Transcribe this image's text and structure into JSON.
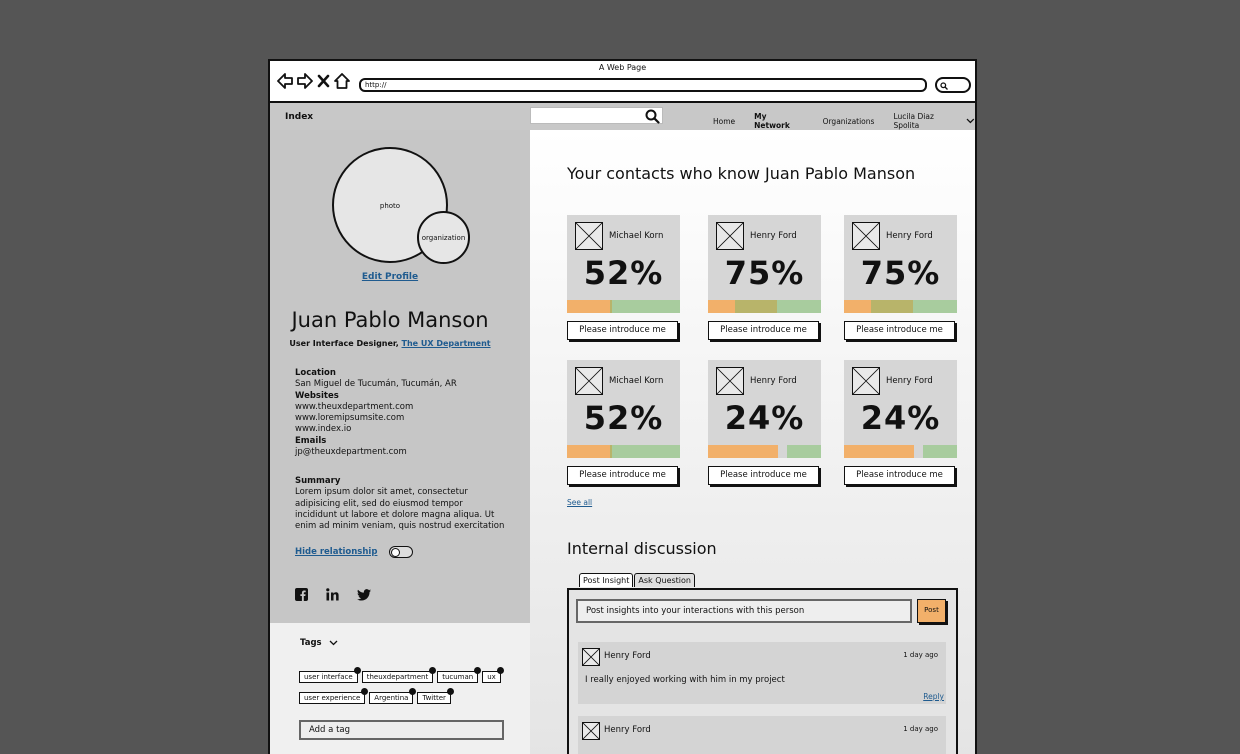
{
  "window": {
    "title": "A Web Page",
    "url": "http://"
  },
  "colors": {
    "orange": "#f2b06a",
    "olive": "#b8b46a",
    "green": "#a8cc9e",
    "link": "#1f5b8f"
  },
  "header": {
    "brand": "Index",
    "search_placeholder": "",
    "nav": [
      {
        "label": "Home",
        "active": false
      },
      {
        "label": "My Network",
        "active": true
      },
      {
        "label": "Organizations",
        "active": false
      }
    ],
    "user": "Lucila Diaz Spolita"
  },
  "profile": {
    "photo_label": "photo",
    "org_label": "organization",
    "edit_link": "Edit Profile",
    "name": "Juan Pablo Manson",
    "role": "User Interface Designer,",
    "department": "The UX Department",
    "location_label": "Location",
    "location": "San Miguel de Tucumán, Tucumán, AR",
    "websites_label": "Websites",
    "websites": [
      "www.theuxdepartment.com",
      "www.loremipsumsite.com",
      "www.index.io"
    ],
    "emails_label": "Emails",
    "email": "jp@theuxdepartment.com",
    "summary_label": "Summary",
    "summary_lines": [
      "Lorem ipsum dolor sit amet, consectetur",
      "adipisicing elit, sed do eiusmod tempor",
      "incididunt ut labore et dolore magna aliqua. Ut",
      "enim ad minim veniam, quis nostrud exercitation"
    ],
    "hide_relationship": "Hide relationship",
    "socials": [
      "facebook-icon",
      "linkedin-icon",
      "twitter-icon"
    ]
  },
  "tags": {
    "title": "Tags",
    "items": [
      "user interface",
      "theuxdepartment",
      "tucuman",
      "ux",
      "user experience",
      "Argentina",
      "Twitter"
    ],
    "add_placeholder": "Add a tag"
  },
  "contacts": {
    "title": "Your contacts who know Juan Pablo Manson",
    "button_label": "Please introduce me",
    "items": [
      {
        "name": "Michael Korn",
        "percent": "52%",
        "bar": [
          [
            "orange",
            0.38
          ],
          [
            "olive",
            0.02
          ],
          [
            "green",
            0.6
          ]
        ]
      },
      {
        "name": "Henry Ford",
        "percent": "75%",
        "bar": [
          [
            "orange",
            0.24
          ],
          [
            "olive",
            0.37
          ],
          [
            "green",
            0.39
          ]
        ]
      },
      {
        "name": "Henry Ford",
        "percent": "75%",
        "bar": [
          [
            "orange",
            0.24
          ],
          [
            "olive",
            0.37
          ],
          [
            "green",
            0.39
          ]
        ]
      },
      {
        "name": "Michael Korn",
        "percent": "52%",
        "bar": [
          [
            "orange",
            0.38
          ],
          [
            "olive",
            0.02
          ],
          [
            "green",
            0.6
          ]
        ]
      },
      {
        "name": "Henry Ford",
        "percent": "24%",
        "bar": [
          [
            "orange",
            0.62
          ],
          [
            "none",
            0.08
          ],
          [
            "green",
            0.3
          ]
        ]
      },
      {
        "name": "Henry Ford",
        "percent": "24%",
        "bar": [
          [
            "orange",
            0.62
          ],
          [
            "none",
            0.08
          ],
          [
            "green",
            0.3
          ]
        ]
      }
    ],
    "see_all": "See all"
  },
  "discussion": {
    "title": "Internal discussion",
    "tabs": [
      "Post Insight",
      "Ask Question"
    ],
    "input_placeholder": "Post insights into your interactions with this person",
    "post_label": "Post",
    "comments": [
      {
        "author": "Henry Ford",
        "time": "1 day ago",
        "text": "I really enjoyed working with him in my project",
        "reply": "Reply"
      },
      {
        "author": "Henry Ford",
        "time": "1 day ago",
        "text": "",
        "reply": ""
      }
    ]
  }
}
